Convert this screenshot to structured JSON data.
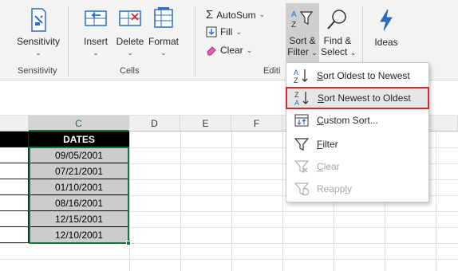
{
  "ribbon": {
    "sensitivity": {
      "label": "Sensitivity",
      "group_label": "Sensitivity"
    },
    "cells": {
      "insert_label": "Insert",
      "delete_label": "Delete",
      "format_label": "Format",
      "group_label": "Cells"
    },
    "editing": {
      "autosum_label": "AutoSum",
      "fill_label": "Fill",
      "clear_label": "Clear",
      "sort_filter_line1": "Sort &",
      "sort_filter_line2": "Filter",
      "find_select_line1": "Find &",
      "find_select_line2": "Select",
      "group_label": "Editi"
    },
    "ideas": {
      "label": "Ideas"
    }
  },
  "sheet": {
    "columns": [
      "C",
      "D",
      "E",
      "F"
    ],
    "header_value": "DATES",
    "dates": [
      "09/05/2001",
      "07/21/2001",
      "01/10/2001",
      "08/16/2001",
      "12/15/2001",
      "12/10/2001"
    ]
  },
  "menu": {
    "items": [
      {
        "label_pre": "",
        "label_key": "S",
        "label_post": "ort Oldest to Newest"
      },
      {
        "label_pre": "",
        "label_key": "S",
        "label_post": "ort Newest to Oldest"
      },
      {
        "label_pre": "",
        "label_key": "C",
        "label_post": "ustom Sort..."
      },
      {
        "label_pre": "",
        "label_key": "F",
        "label_post": "ilter"
      },
      {
        "label_pre": "",
        "label_key": "C",
        "label_post": "lear"
      },
      {
        "label_pre": "Reapp",
        "label_key": "l",
        "label_post": "y"
      }
    ]
  },
  "colors": {
    "selection_green": "#1e7145",
    "highlight_red": "#d42b2b",
    "accent_blue": "#2b6cc4"
  }
}
